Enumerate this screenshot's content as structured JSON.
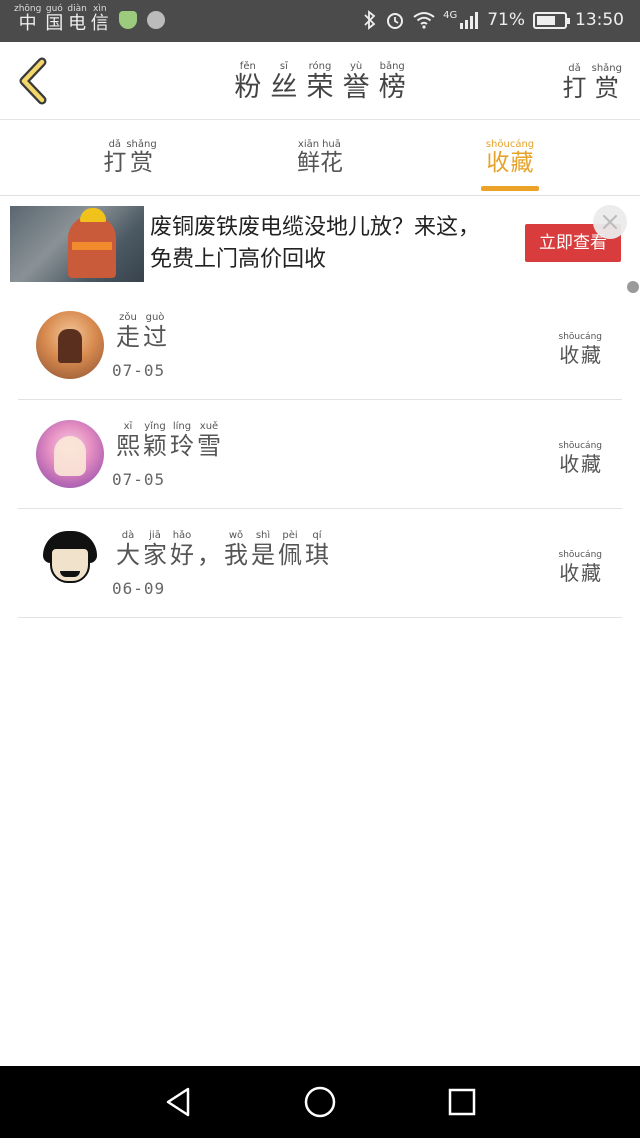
{
  "status_bar": {
    "carrier": [
      {
        "h": "中",
        "p": "zhōng"
      },
      {
        "h": "国",
        "p": "guó"
      },
      {
        "h": "电",
        "p": "diàn"
      },
      {
        "h": "信",
        "p": "xìn"
      }
    ],
    "network": "4G",
    "battery": "71%",
    "battery_level": 0.71,
    "time": "13:50"
  },
  "header": {
    "title": [
      {
        "h": "粉",
        "p": "fěn"
      },
      {
        "h": "丝",
        "p": "sī"
      },
      {
        "h": "荣",
        "p": "róng"
      },
      {
        "h": "誉",
        "p": "yù"
      },
      {
        "h": "榜",
        "p": "bǎng"
      }
    ],
    "action": [
      {
        "h": "打",
        "p": "dǎ"
      },
      {
        "h": "赏",
        "p": "shǎng"
      }
    ]
  },
  "tabs": [
    {
      "chars": [
        {
          "h": "打",
          "p": "dǎ"
        },
        {
          "h": "赏",
          "p": "shǎng"
        }
      ],
      "active": false
    },
    {
      "chars": [
        {
          "h": "鲜",
          "p": "xiān"
        },
        {
          "h": "花",
          "p": "huā"
        }
      ],
      "active": false
    },
    {
      "chars": [
        {
          "h": "收",
          "p": "shōu"
        },
        {
          "h": "藏",
          "p": "cáng"
        }
      ],
      "active": true
    }
  ],
  "ad": {
    "text": "废铜废铁废电缆没地儿放？来这，免费上门高价回收",
    "button": "立即查看"
  },
  "list": [
    {
      "name": [
        {
          "h": "走",
          "p": "zǒu"
        },
        {
          "h": "过",
          "p": "guò"
        }
      ],
      "date": "07-05",
      "action": [
        {
          "h": "收",
          "p": "shōu"
        },
        {
          "h": "藏",
          "p": "cáng"
        }
      ]
    },
    {
      "name": [
        {
          "h": "熙",
          "p": "xī"
        },
        {
          "h": "颖",
          "p": "yǐng"
        },
        {
          "h": "玲",
          "p": "líng"
        },
        {
          "h": "雪",
          "p": "xuě"
        }
      ],
      "date": "07-05",
      "action": [
        {
          "h": "收",
          "p": "shōu"
        },
        {
          "h": "藏",
          "p": "cáng"
        }
      ]
    },
    {
      "name": [
        {
          "h": "大",
          "p": "dà"
        },
        {
          "h": "家",
          "p": "jiā"
        },
        {
          "h": "好",
          "p": "hǎo"
        },
        {
          "h": "，",
          "p": ""
        },
        {
          "h": "我",
          "p": "wǒ"
        },
        {
          "h": "是",
          "p": "shì"
        },
        {
          "h": "佩",
          "p": "pèi"
        },
        {
          "h": "琪",
          "p": "qí"
        }
      ],
      "date": "06-09",
      "action": [
        {
          "h": "收",
          "p": "shōu"
        },
        {
          "h": "藏",
          "p": "cáng"
        }
      ]
    }
  ],
  "icons": {
    "back": "chevron-left-icon",
    "bluetooth": "bluetooth-icon",
    "alarm": "alarm-icon",
    "wifi": "wifi-icon",
    "signal": "signal-icon",
    "battery": "battery-icon",
    "close": "close-icon",
    "nav_back": "triangle-back-icon",
    "nav_home": "circle-home-icon",
    "nav_recent": "square-recent-icon"
  },
  "colors": {
    "accent": "#eaa227",
    "status_bar": "#4b4b4b",
    "ad_button": "#d93c3c"
  }
}
